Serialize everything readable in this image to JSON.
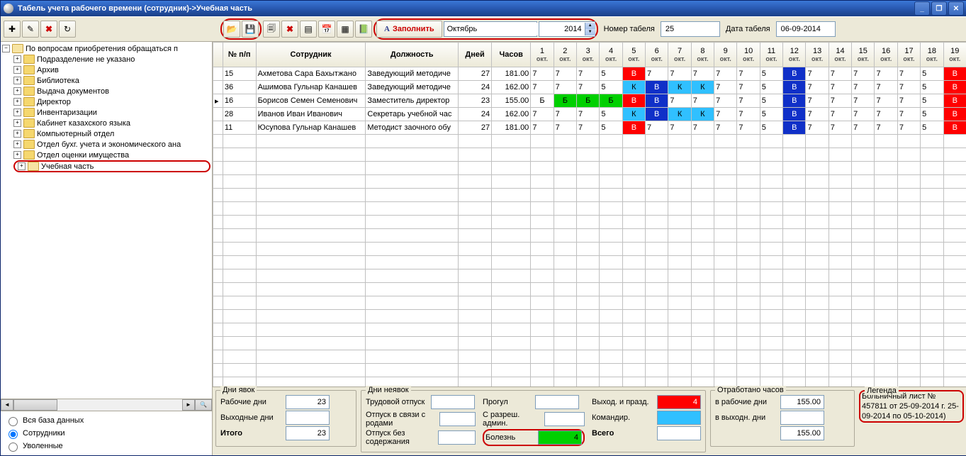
{
  "title": "Табель учета рабочего времени (сотрудник)->Учебная часть",
  "toolbar": {
    "fill_label": "Заполнить",
    "month": "Октябрь",
    "year": "2014",
    "tabno_label": "Номер табеля",
    "tabno": "25",
    "tabdate_label": "Дата табеля",
    "tabdate": "06-09-2014"
  },
  "tree": {
    "root": "По вопросам приобретения обращаться п",
    "items": [
      "Подразделение не указано",
      "Архив",
      "Библиотека",
      "Выдача документов",
      "Директор",
      "Инвентаризации",
      "Кабинет казахского языка",
      "Компьютерный отдел",
      "Отдел бухг. учета и экономического ана",
      "Отдел оценки имущества",
      "Учебная часть"
    ]
  },
  "radios": {
    "all": "Вся база данных",
    "emp": "Сотрудники",
    "fired": "Уволенные"
  },
  "columns": {
    "npp": "№ п/п",
    "emp": "Сотрудник",
    "pos": "Должность",
    "days": "Дней",
    "hours": "Часов"
  },
  "day_suffix": "окт.",
  "rows": [
    {
      "mark": "",
      "npp": "15",
      "emp": "Ахметова Сара Бахытжано",
      "pos": "Заведующий методиче",
      "days": "27",
      "hours": "181.00",
      "cells": [
        "7",
        "7",
        "7",
        "5",
        {
          "v": "В",
          "c": "red"
        },
        "7",
        "7",
        "7",
        "7",
        "7",
        "5",
        {
          "v": "В",
          "c": "navy"
        },
        "7",
        "7",
        "7",
        "7",
        "7",
        "5",
        {
          "v": "В",
          "c": "red"
        }
      ]
    },
    {
      "mark": "",
      "npp": "36",
      "emp": "Ашимова Гульнар Канашев",
      "pos": "Заведующий методиче",
      "days": "24",
      "hours": "162.00",
      "cells": [
        "7",
        "7",
        "7",
        "5",
        {
          "v": "К",
          "c": "cyan"
        },
        {
          "v": "В",
          "c": "navy"
        },
        {
          "v": "К",
          "c": "cyan"
        },
        {
          "v": "К",
          "c": "cyan"
        },
        "7",
        "7",
        "5",
        {
          "v": "В",
          "c": "navy"
        },
        "7",
        "7",
        "7",
        "7",
        "7",
        "5",
        {
          "v": "В",
          "c": "red"
        }
      ]
    },
    {
      "mark": "▸",
      "npp": "16",
      "emp": "Борисов Семен Семенович",
      "pos": "Заместитель директор",
      "days": "23",
      "hours": "155.00",
      "cells": [
        {
          "v": "Б",
          "c": ""
        },
        {
          "v": "Б",
          "c": "green"
        },
        {
          "v": "Б",
          "c": "green"
        },
        {
          "v": "Б",
          "c": "green"
        },
        {
          "v": "В",
          "c": "red"
        },
        {
          "v": "В",
          "c": "navy"
        },
        "7",
        "7",
        "7",
        "7",
        "5",
        {
          "v": "В",
          "c": "navy"
        },
        "7",
        "7",
        "7",
        "7",
        "7",
        "5",
        {
          "v": "В",
          "c": "red"
        }
      ]
    },
    {
      "mark": "",
      "npp": "28",
      "emp": "Иванов Иван Иванович",
      "pos": "Секретарь учебной час",
      "days": "24",
      "hours": "162.00",
      "cells": [
        "7",
        "7",
        "7",
        "5",
        {
          "v": "К",
          "c": "cyan"
        },
        {
          "v": "В",
          "c": "navy"
        },
        {
          "v": "К",
          "c": "cyan"
        },
        {
          "v": "К",
          "c": "cyan"
        },
        "7",
        "7",
        "5",
        {
          "v": "В",
          "c": "navy"
        },
        "7",
        "7",
        "7",
        "7",
        "7",
        "5",
        {
          "v": "В",
          "c": "red"
        }
      ]
    },
    {
      "mark": "",
      "npp": "11",
      "emp": "Юсупова Гульнар Канашев",
      "pos": "Методист заочного обу",
      "days": "27",
      "hours": "181.00",
      "cells": [
        "7",
        "7",
        "7",
        "5",
        {
          "v": "В",
          "c": "red"
        },
        "7",
        "7",
        "7",
        "7",
        "7",
        "5",
        {
          "v": "В",
          "c": "navy"
        },
        "7",
        "7",
        "7",
        "7",
        "7",
        "5",
        {
          "v": "В",
          "c": "red"
        }
      ]
    }
  ],
  "bottom": {
    "attend": {
      "title": "Дни явок",
      "work": "Рабочие дни",
      "work_v": "23",
      "weekend": "Выходные дни",
      "weekend_v": "",
      "total": "Итого",
      "total_v": "23"
    },
    "absence": {
      "title": "Дни неявок",
      "vac": "Трудовой отпуск",
      "vac_v": "",
      "mat": "Отпуск в связи с родами",
      "mat_v": "",
      "unpaid": "Отпуск без содержания",
      "unpaid_v": "",
      "truancy": "Прогул",
      "truancy_v": "",
      "admin": "С разреш. админ.",
      "admin_v": "",
      "sick": "Болезнь",
      "sick_v": "4",
      "holiday": "Выход. и празд.",
      "holiday_v": "4",
      "trip": "Командир.",
      "trip_v": "",
      "sum": "Всего",
      "sum_v": ""
    },
    "worked": {
      "title": "Отработано часов",
      "wd": "в рабочие дни",
      "wd_v": "155.00",
      "we": "в выходн. дни",
      "we_v": "",
      "tot_v": "155.00"
    },
    "legend": {
      "title": "Легенда",
      "text": "Больничный лист № 457811 от 25-09-2014 г. 25-09-2014 по 05-10-2014)"
    }
  }
}
